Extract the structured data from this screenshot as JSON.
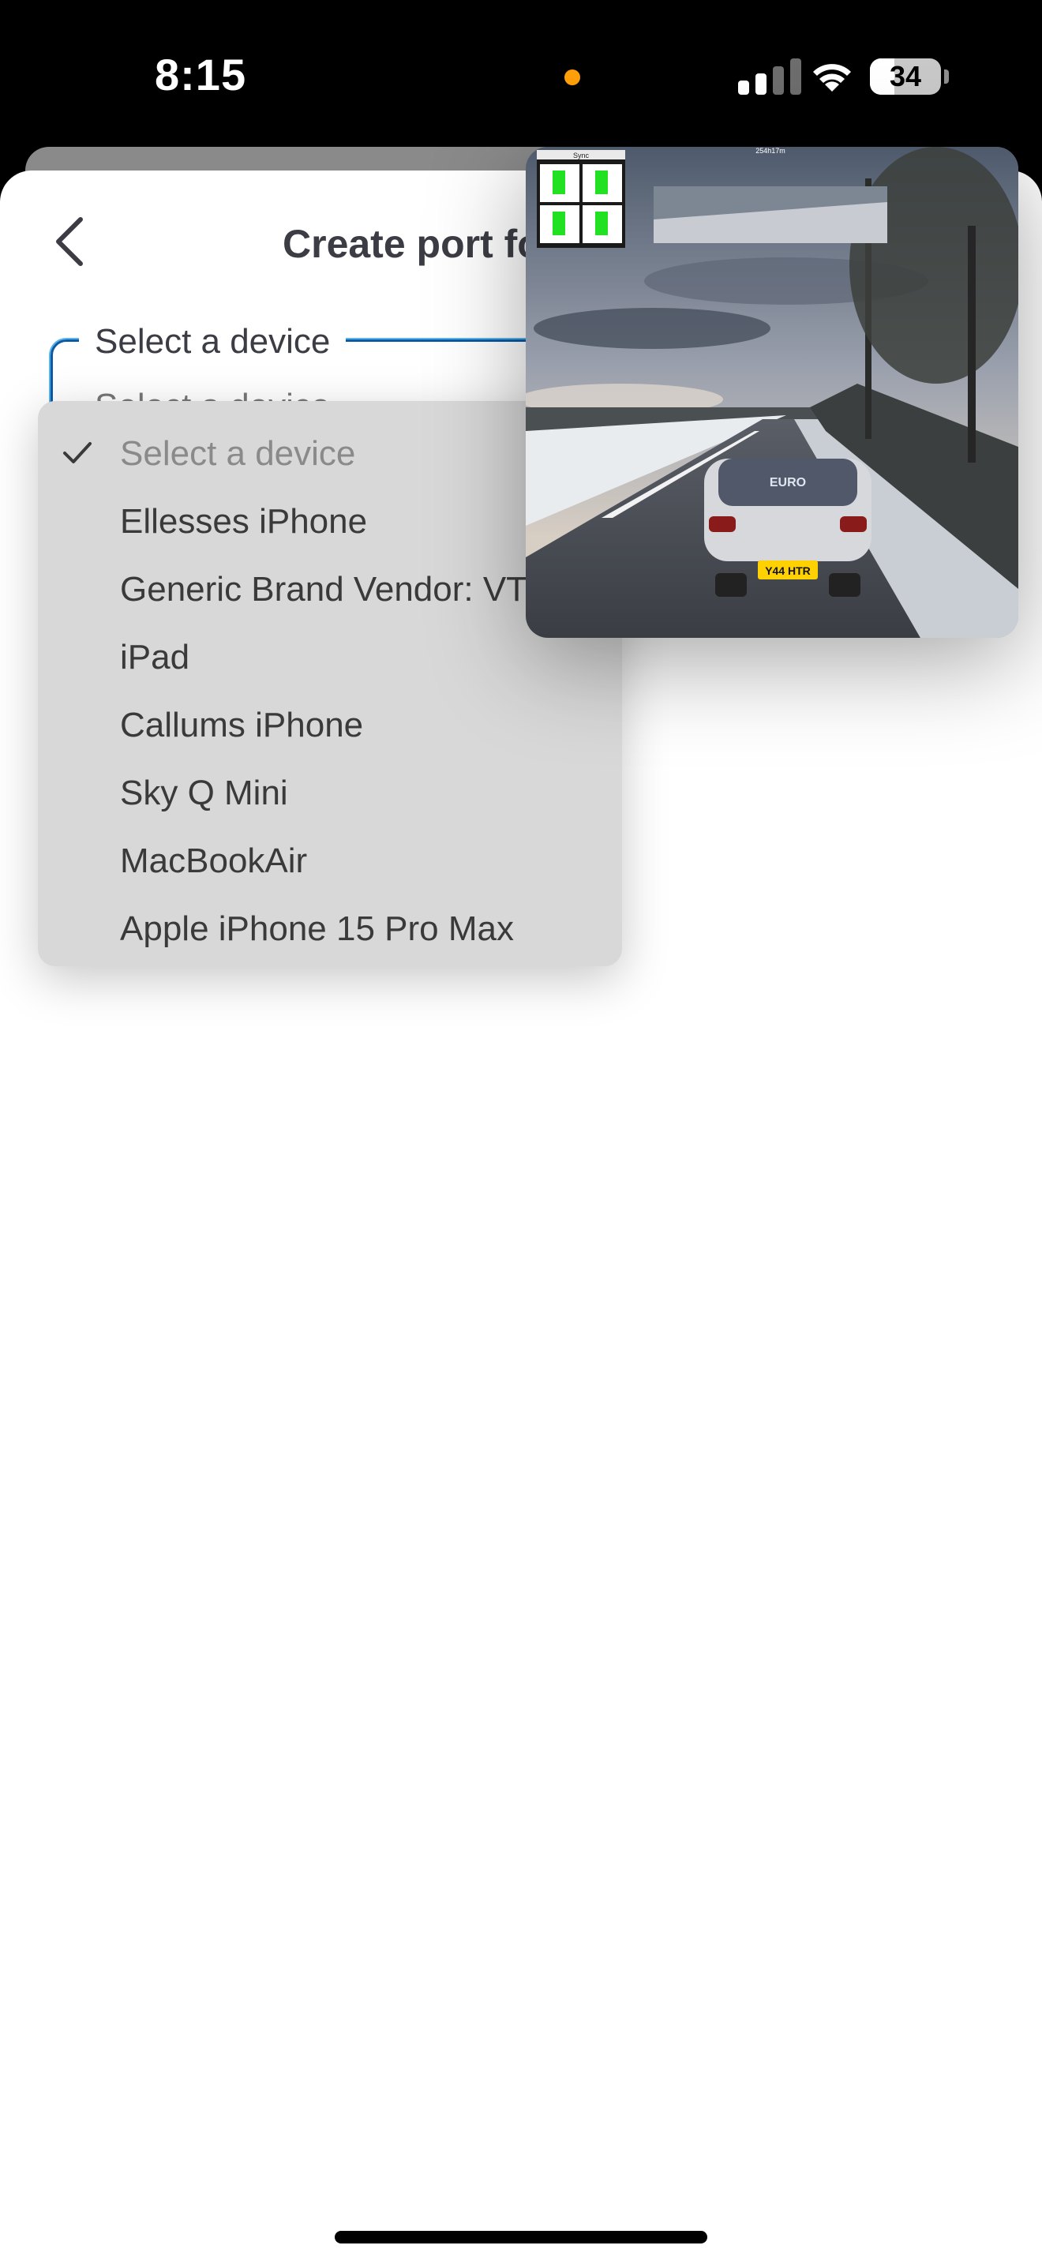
{
  "status_bar": {
    "time": "8:15",
    "battery": "34",
    "battery_level": 0.34,
    "signal_icon": "cellular-signal-icon",
    "wifi_icon": "wifi-icon",
    "privacy_indicator_color": "#ff9f0a"
  },
  "header": {
    "title": "Create port fo",
    "back_icon": "chevron-left-icon"
  },
  "form": {
    "device_field_label": "Select a device",
    "device_field_value": "Select a device"
  },
  "dropdown": {
    "selected_icon": "checkmark-icon",
    "items": [
      {
        "label": "Select a device",
        "selected": true
      },
      {
        "label": "Ellesses iPhone",
        "selected": false
      },
      {
        "label": "Generic Brand Vendor: VT",
        "selected": false
      },
      {
        "label": "iPad",
        "selected": false
      },
      {
        "label": "Callums iPhone",
        "selected": false
      },
      {
        "label": "Sky Q Mini",
        "selected": false
      },
      {
        "label": "MacBookAir",
        "selected": false
      },
      {
        "label": "Apple iPhone 15 Pro Max",
        "selected": false
      }
    ]
  },
  "pip_video": {
    "overlay_header": "Sync",
    "overlay_top_text": "254h17m",
    "plate_text": "Y44 HTR",
    "sticker_text": "EURO"
  },
  "colors": {
    "accent_border": "#0a5aa8",
    "accent_glow": "#5ab4e6",
    "dropdown_bg": "#d8d8d8",
    "title_text": "#3c3c44"
  }
}
